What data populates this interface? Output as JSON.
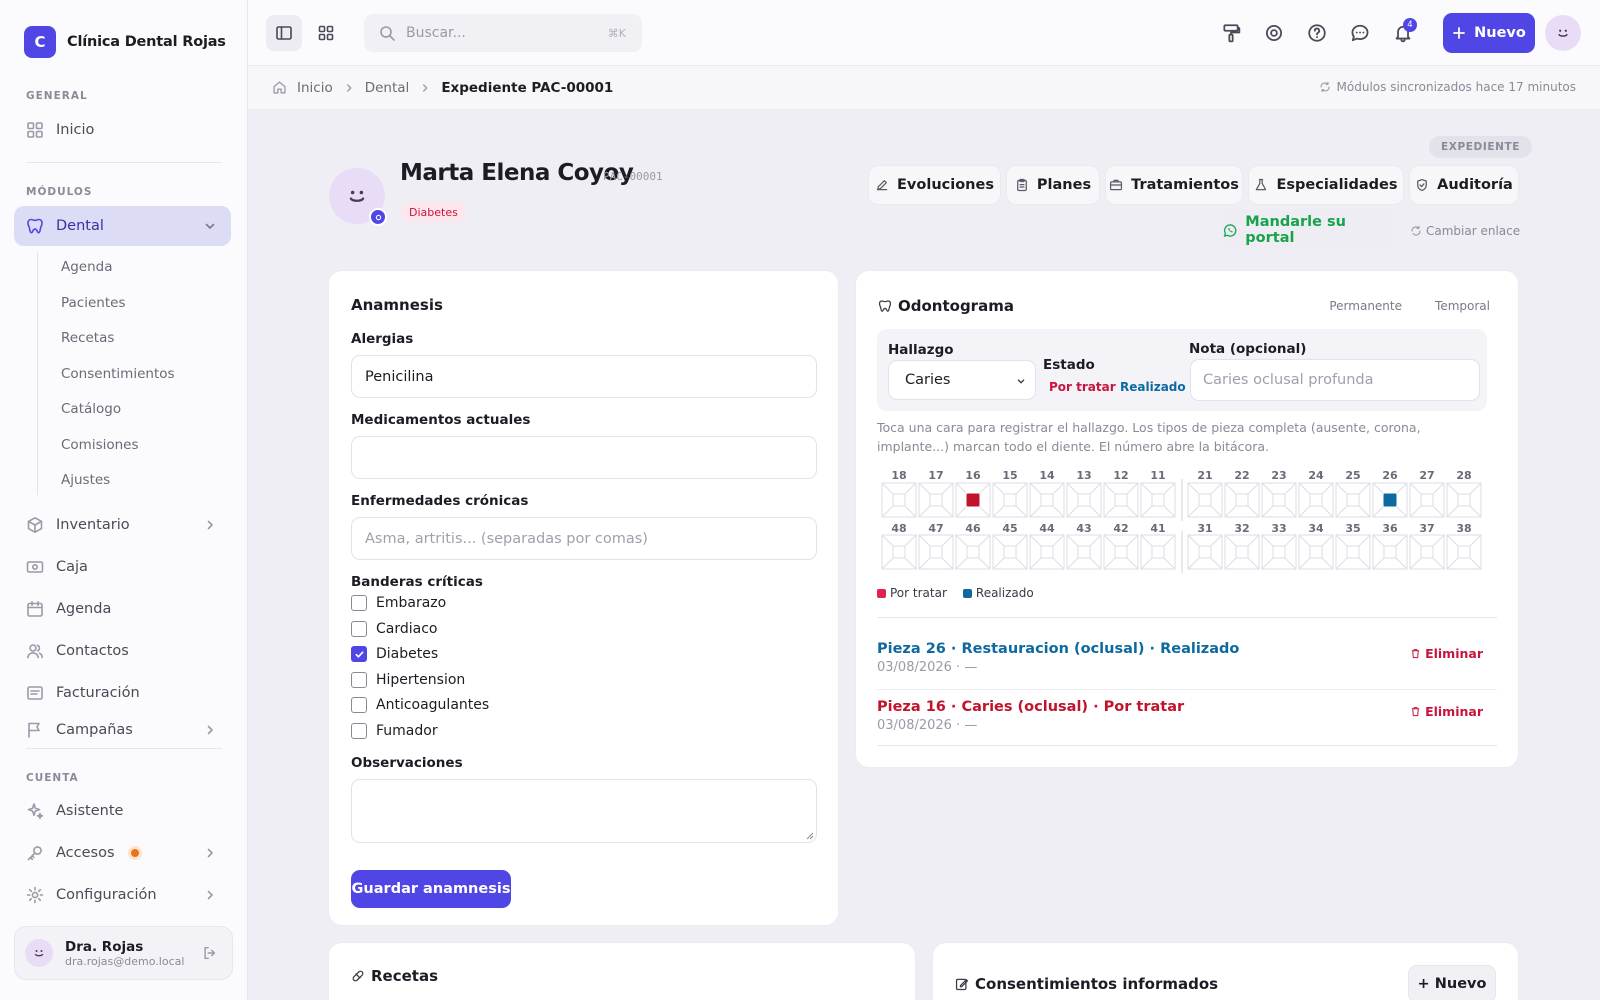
{
  "brand": {
    "initial": "C",
    "name": "Clínica Dental Rojas"
  },
  "sidebar": {
    "section_general": "GENERAL",
    "section_modules": "MÓDULOS",
    "section_account": "CUENTA",
    "inicio": "Inicio",
    "dental": "Dental",
    "dental_sub": [
      "Agenda",
      "Pacientes",
      "Recetas",
      "Consentimientos",
      "Catálogo",
      "Comisiones",
      "Ajustes"
    ],
    "inventario": "Inventario",
    "caja": "Caja",
    "agenda": "Agenda",
    "contactos": "Contactos",
    "facturacion": "Facturación",
    "campanas": "Campañas",
    "asistente": "Asistente",
    "accesos": "Accesos",
    "configuracion": "Configuración"
  },
  "user": {
    "name": "Dra. Rojas",
    "email": "dra.rojas@demo.local"
  },
  "topbar": {
    "search_placeholder": "Buscar...",
    "search_shortcut": "⌘K",
    "notif_count": "4",
    "new_label": "Nuevo"
  },
  "breadcrumb": {
    "home": "Inicio",
    "section": "Dental",
    "current": "Expediente PAC-00001",
    "sync": "Módulos sincronizados hace 17 minutos"
  },
  "patient": {
    "tag": "EXPEDIENTE",
    "name": "Marta Elena Coyoy",
    "id": "PAC-00001",
    "chip": "Diabetes"
  },
  "tabs": [
    "Evoluciones",
    "Planes",
    "Tratamientos",
    "Especialidades",
    "Auditoría"
  ],
  "portal": {
    "send": "Mandarle su portal",
    "change": "Cambiar enlace"
  },
  "anamnesis": {
    "title": "Anamnesis",
    "alergias_label": "Alergias",
    "alergias_value": "Penicilina",
    "medicamentos_label": "Medicamentos actuales",
    "medicamentos_value": "",
    "cronicas_label": "Enfermedades crónicas",
    "cronicas_placeholder": "Asma, artritis... (separadas por comas)",
    "banderas_label": "Banderas críticas",
    "flags": [
      {
        "label": "Embarazo",
        "checked": false
      },
      {
        "label": "Cardiaco",
        "checked": false
      },
      {
        "label": "Diabetes",
        "checked": true
      },
      {
        "label": "Hipertension",
        "checked": false
      },
      {
        "label": "Anticoagulantes",
        "checked": false
      },
      {
        "label": "Fumador",
        "checked": false
      }
    ],
    "observaciones_label": "Observaciones",
    "save": "Guardar anamnesis"
  },
  "odontograma": {
    "title": "Odontograma",
    "mode_perm": "Permanente",
    "mode_temp": "Temporal",
    "hallazgo_label": "Hallazgo",
    "hallazgo_value": "Caries",
    "estado_label": "Estado",
    "estado_por_tratar": "Por tratar",
    "estado_realizado": "Realizado",
    "nota_label": "Nota (opcional)",
    "nota_placeholder": "Caries oclusal profunda",
    "help": "Toca una cara para registrar el hallazgo. Los tipos de pieza completa (ausente, corona, implante...) marcan todo el diente. El número abre la bitácora.",
    "upper": [
      "18",
      "17",
      "16",
      "15",
      "14",
      "13",
      "12",
      "11",
      "21",
      "22",
      "23",
      "24",
      "25",
      "26",
      "27",
      "28"
    ],
    "lower": [
      "48",
      "47",
      "46",
      "45",
      "44",
      "43",
      "42",
      "41",
      "31",
      "32",
      "33",
      "34",
      "35",
      "36",
      "37",
      "38"
    ],
    "marks": [
      {
        "tooth": "16",
        "status": "por_tratar"
      },
      {
        "tooth": "26",
        "status": "realizado"
      }
    ],
    "legend_por_tratar": "Por tratar",
    "legend_realizado": "Realizado",
    "entries": [
      {
        "title": "Pieza 26 · Restauracion (oclusal) · Realizado",
        "date": "03/08/2026 · —",
        "color": "#0e6a9e",
        "action": "Eliminar"
      },
      {
        "title": "Pieza 16 · Caries (oclusal) · Por tratar",
        "date": "03/08/2026 · —",
        "color": "#c0142c",
        "action": "Eliminar"
      }
    ]
  },
  "recetas": {
    "title": "Recetas"
  },
  "consentimientos": {
    "title": "Consentimientos informados",
    "new": "+ Nuevo"
  },
  "colors": {
    "accent": "#4f46e5",
    "por_tratar": "#c0142c",
    "realizado": "#0e6a9e",
    "portal": "#16a34a"
  }
}
